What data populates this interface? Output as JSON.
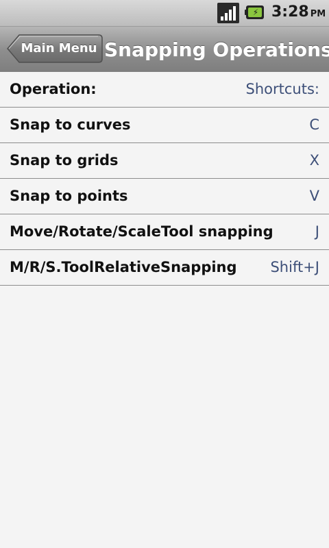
{
  "status_bar": {
    "time": "3:28",
    "ampm": "PM",
    "signal_icon": "signal-bars-icon",
    "battery_icon": "battery-charging-icon",
    "battery_color": "#8bc63f"
  },
  "title_bar": {
    "back_label": "Main Menu",
    "title": "Snapping Operations"
  },
  "table": {
    "header": {
      "operation": "Operation:",
      "shortcut": "Shortcuts:"
    },
    "rows": [
      {
        "operation": "Snap to curves",
        "shortcut": "C"
      },
      {
        "operation": "Snap to grids",
        "shortcut": "X"
      },
      {
        "operation": "Snap to points",
        "shortcut": "V"
      },
      {
        "operation": "Move/Rotate/ScaleTool snapping",
        "shortcut": "J"
      },
      {
        "operation": "M/R/S.ToolRelativeSnapping",
        "shortcut": "Shift+J"
      }
    ]
  },
  "colors": {
    "shortcut_text": "#3d4f78",
    "title_text": "#ffffff"
  }
}
